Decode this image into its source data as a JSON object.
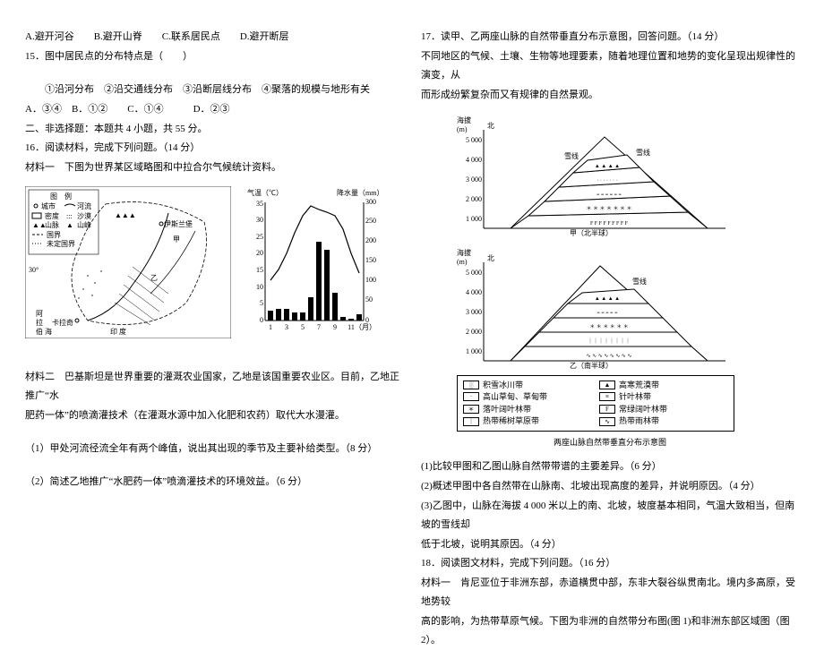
{
  "left": {
    "q14_options": "A.避开河谷　　B.避开山脊　　C.联系居民点　　D.避开断层",
    "q15_stem": "15．图中居民点的分布特点是（　　）",
    "q15_items": "①沿河分布　②沿交通线分布　③沿断层线分布　④聚落的规模与地形有关",
    "q15_choices": "A．③④　B．①②　　C．①④　　　D．②③",
    "section2": "二、非选择题：本题共 4 小题，共 55 分。",
    "q16_stem": "16．阅读材料，完成下列问题。（14 分）",
    "q16_m1": "材料一　下图为世界某区域略图和中拉合尔气候统计资料。",
    "map_legend_title": "图　例",
    "map_legend": {
      "city": "城市",
      "river": "河流",
      "desert": "沙漠",
      "dot": "密 度",
      "mtn": "山 脉",
      "peak": "山峰",
      "border": "国 界",
      "undef": "未定国界"
    },
    "climate_labels": {
      "temp": "气温（℃）",
      "precip": "降水量（mm）",
      "month": "（月）"
    },
    "q16_m2a": "材料二　巴基斯坦是世界重要的灌溉农业国家，乙地是该国重要农业区。目前，乙地正推广“水",
    "q16_m2b": "肥药一体”的喷滴灌技术（在灌溉水源中加入化肥和农药）取代大水漫灌。",
    "q16_1": "（1）甲处河流径流全年有两个峰值，说出其出现的季节及主要补给类型。（8 分）",
    "q16_2": "（2）简述乙地推广“水肥药一体”喷滴灌技术的环境效益。（6 分）"
  },
  "right": {
    "q17_stem": "17．读甲、乙两座山脉的自然带垂直分布示意图，回答问题。（14 分）",
    "q17_intro1": "不同地区的气候、土壤、生物等地理要素，随着地理位置和地势的变化呈现出规律性的演变，从",
    "q17_intro2": "而形成纷繁复杂而又有规律的自然景观。",
    "axis_label_alt": "海拔\n(m)",
    "ticks": [
      "5 000",
      "4 000",
      "3 000",
      "2 000",
      "1 000"
    ],
    "north": "北",
    "mtn_a_sub": "甲（北半球）",
    "mtn_b_sub": "乙（南半球）",
    "snowline": "雪线",
    "legend": {
      "a": "积雪冰川带",
      "b": "高寒荒漠带",
      "c": "高山草甸、草甸带",
      "d": "针叶林带",
      "e": "落叶阔叶林带",
      "f": "常绿阔叶林带",
      "g": "热带稀树草原带",
      "h": "热带雨林带"
    },
    "fig_caption": "两座山脉自然带垂直分布示意图",
    "q17_1": "(1)比较甲图和乙图山脉自然带带谱的主要差异。（6 分）",
    "q17_2": "(2)概述甲图中各自然带在山脉南、北坡出现高度的差异，并说明原因。（4 分）",
    "q17_3a": "(3)乙图中，山脉在海拔 4 000 米以上的南、北坡，坡度基本相同，气温大致相当，但南坡的雪线却",
    "q17_3b": "低于北坡，说明其原因。（4 分）",
    "q18_stem": "18．阅读图文材料，完成下列问题。（16 分）",
    "q18_m1a": "材料一　肯尼亚位于非洲东部，赤道横贯中部，东非大裂谷纵贯南北。境内多高原，受地势较",
    "q18_m1b": "高的影响，为热带草原气候。下图为非洲的自然带分布图(图 1)和非洲东部区域图（图 2）。"
  },
  "chart_data": {
    "type": "combo",
    "title": "",
    "x": [
      1,
      2,
      3,
      4,
      5,
      6,
      7,
      8,
      9,
      10,
      11,
      12
    ],
    "series": [
      {
        "name": "气温（℃）",
        "type": "line",
        "axis": "left",
        "values": [
          12,
          15,
          20,
          26,
          31,
          34,
          33,
          32,
          31,
          27,
          20,
          14
        ]
      },
      {
        "name": "降水量（mm）",
        "type": "bar",
        "axis": "right",
        "values": [
          25,
          30,
          30,
          20,
          20,
          60,
          200,
          180,
          70,
          10,
          5,
          15
        ]
      }
    ],
    "xlabel": "（月）",
    "y_left": {
      "label": "气温（℃）",
      "lim": [
        0,
        35
      ],
      "ticks": [
        0,
        5,
        10,
        15,
        20,
        25,
        30,
        35
      ]
    },
    "y_right": {
      "label": "降水量（mm）",
      "lim": [
        0,
        300
      ],
      "ticks": [
        0,
        50,
        100,
        150,
        200,
        250,
        300
      ]
    }
  }
}
